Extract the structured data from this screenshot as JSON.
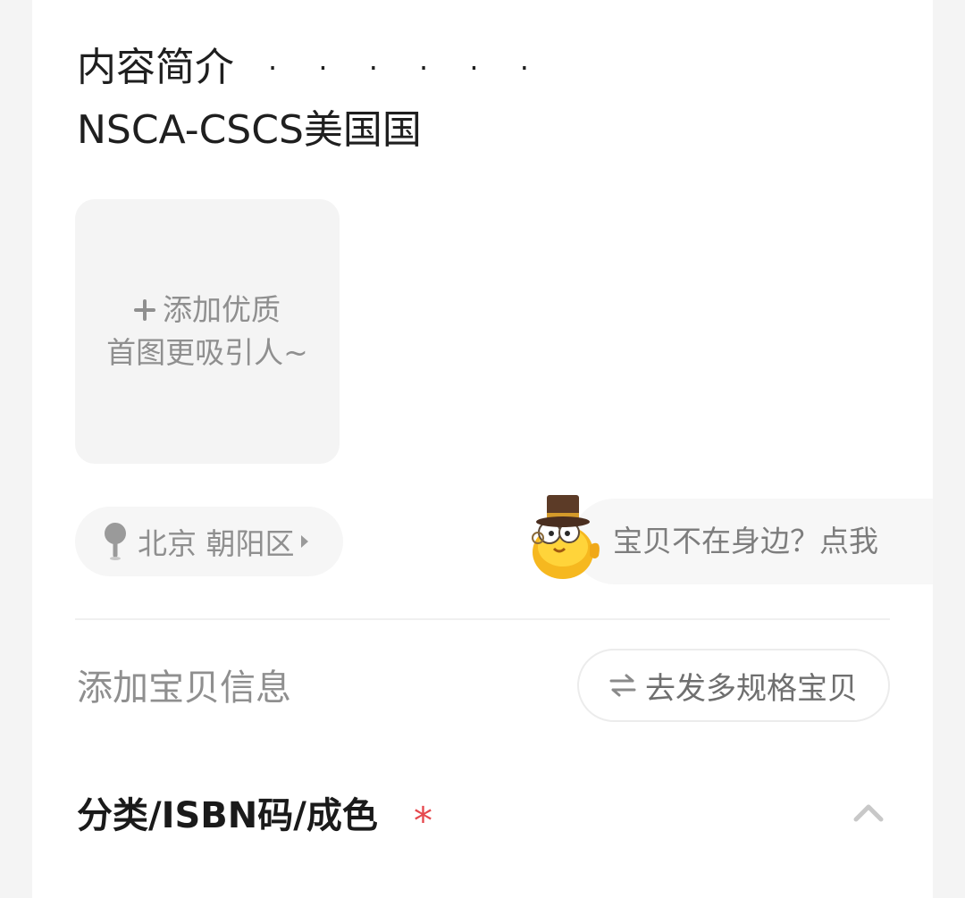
{
  "description": {
    "title": "内容简介",
    "dots": "· · · · · ·",
    "text": "NSCA-CSCS美国国"
  },
  "add_photo": {
    "line1": "添加优质",
    "line2": "首图更吸引人~",
    "icon": "plus-icon"
  },
  "location": {
    "text": "北京 朝阳区",
    "icon": "map-pin-icon"
  },
  "helper": {
    "text": "宝贝不在身边？点我",
    "icon": "mascot-icon"
  },
  "info": {
    "title": "添加宝贝信息",
    "multi_spec_button": "去发多规格宝贝",
    "multi_spec_icon": "swap-icon"
  },
  "category_section": {
    "title": "分类/ISBN码/成色",
    "required_mark": "*",
    "toggle_icon": "chevron-up-icon"
  },
  "colors": {
    "required": "#e5484d",
    "muted_text": "#8f8f8f",
    "card_bg": "#ffffff",
    "page_bg": "#f4f4f4"
  }
}
